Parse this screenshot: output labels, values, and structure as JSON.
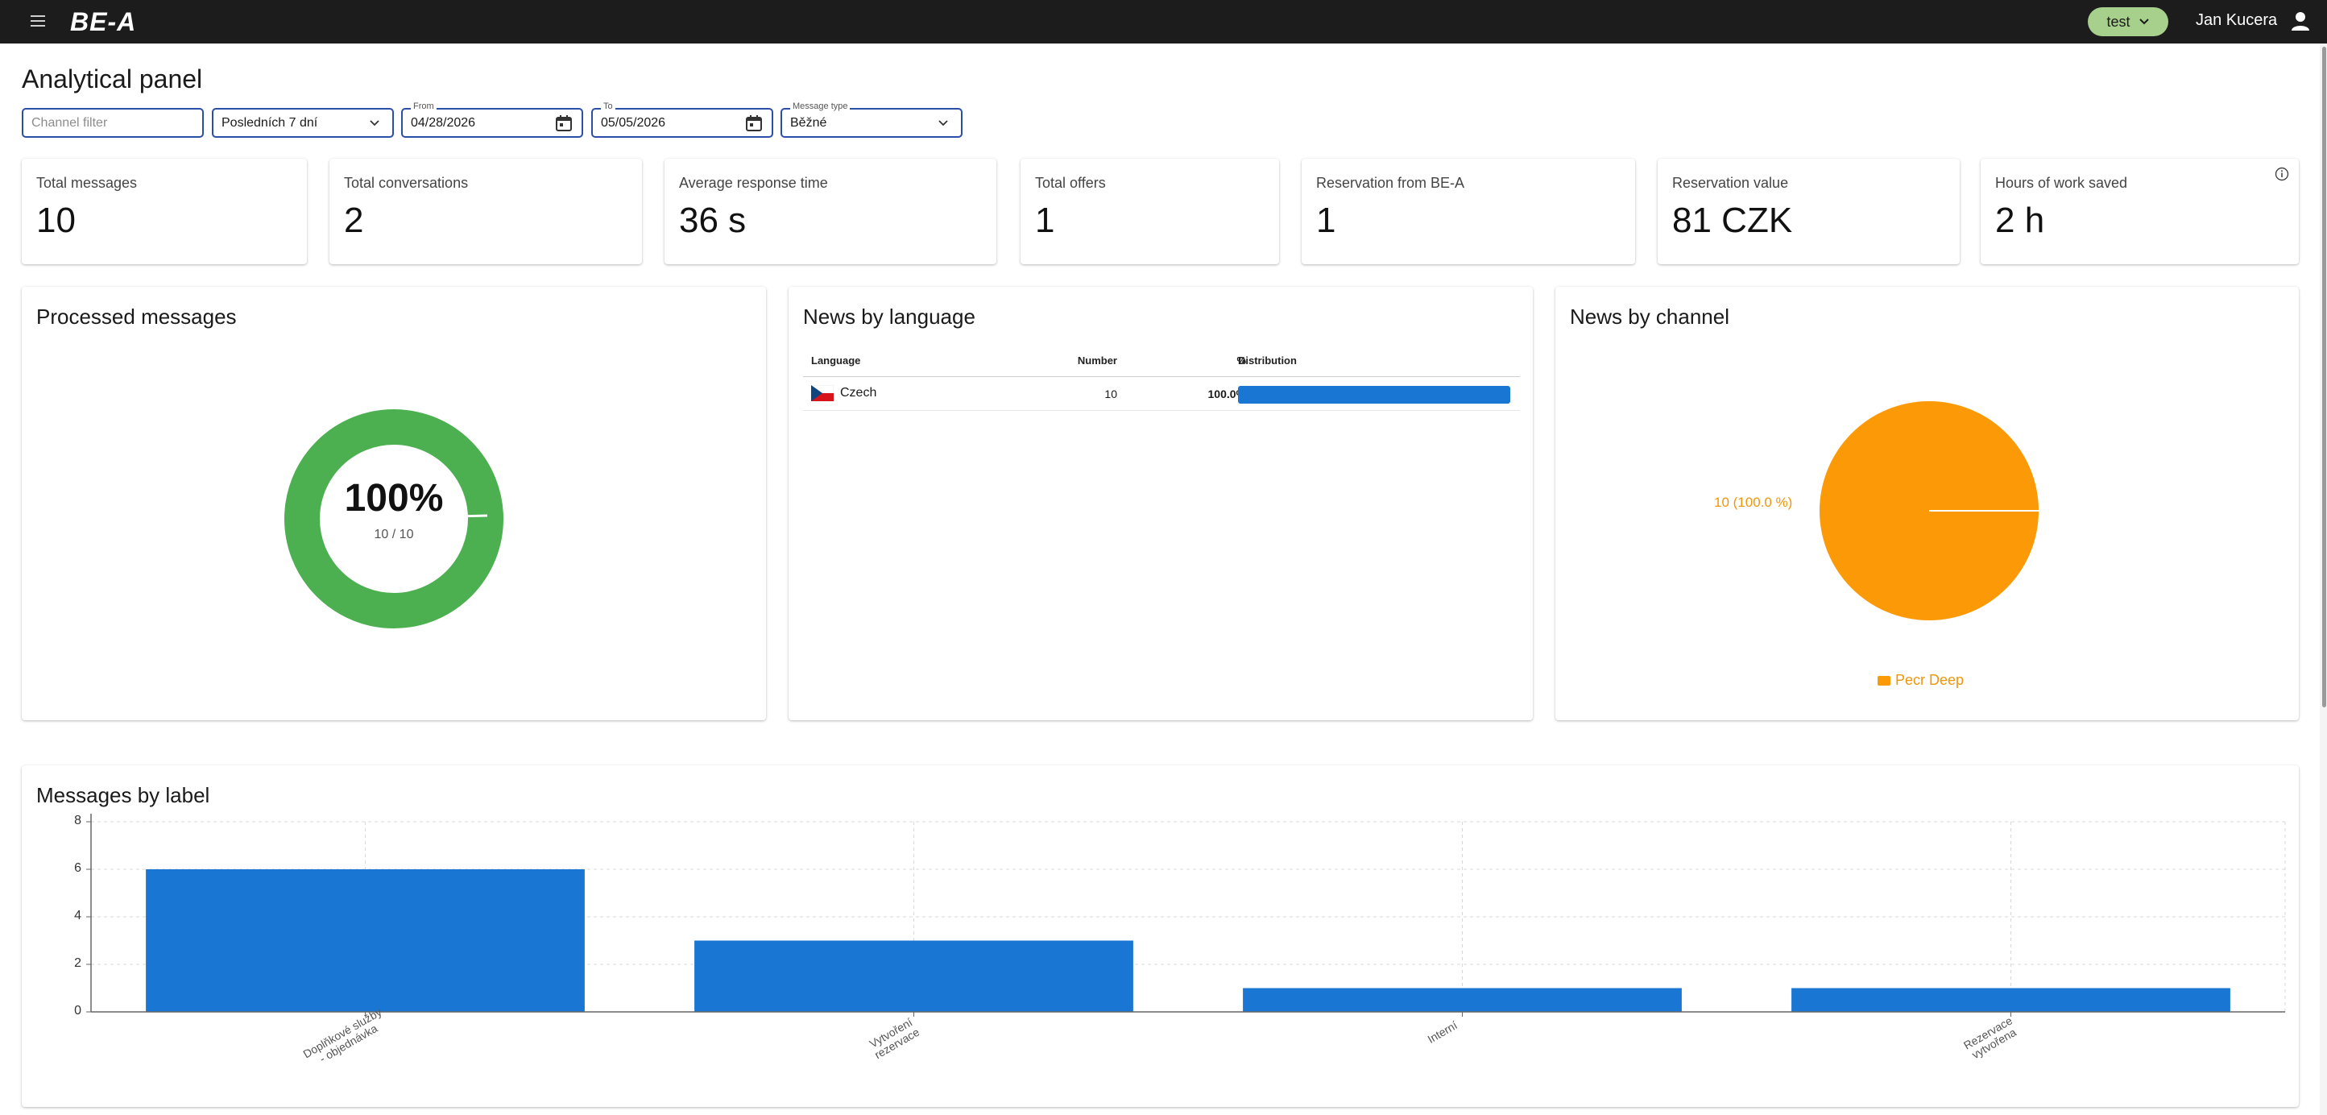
{
  "app": {
    "logo": "BE-A",
    "environment": "test",
    "user_name": "Jan Kucera"
  },
  "page": {
    "title": "Analytical panel"
  },
  "filters": {
    "channel_placeholder": "Channel filter",
    "period": "Posledních 7 dní",
    "from_label": "From",
    "from_value": "04/28/2026",
    "to_label": "To",
    "to_value": "05/05/2026",
    "message_type_label": "Message type",
    "message_type_value": "Běžné"
  },
  "stats": [
    {
      "label": "Total messages",
      "value": "10"
    },
    {
      "label": "Total conversations",
      "value": "2"
    },
    {
      "label": "Average response time",
      "value": "36 s"
    },
    {
      "label": "Total offers",
      "value": "1"
    },
    {
      "label": "Reservation from BE-A",
      "value": "1"
    },
    {
      "label": "Reservation value",
      "value": "81 CZK"
    },
    {
      "label": "Hours of work saved",
      "value": "2 h"
    }
  ],
  "processed": {
    "title": "Processed messages",
    "percent_text": "100%",
    "ratio_text": "10 / 10",
    "fraction": 0.995,
    "color": "#4caf50"
  },
  "language": {
    "title": "News by language",
    "headers": {
      "language": "Language",
      "number": "Number",
      "percent": "%",
      "distribution": "Distribution"
    },
    "rows": [
      {
        "language": "Czech",
        "number": "10",
        "percent": "100.0%",
        "share": 1.0
      }
    ],
    "bar_color": "#1976d2"
  },
  "channel": {
    "title": "News by channel",
    "slice_label": "10 (100.0 %)",
    "legend": "Pecr Deep",
    "color": "#fb9a06"
  },
  "label_chart": {
    "title": "Messages by label"
  },
  "chart_data": {
    "type": "bar",
    "title": "Messages by label",
    "categories": [
      "Doplňkové služby\n- objednávka",
      "Vytvoření\nrezervace",
      "Interní",
      "Rezervace\nvytvořena"
    ],
    "values": [
      6,
      3,
      1,
      1
    ],
    "yticks": [
      0,
      2,
      4,
      6,
      8
    ],
    "ylim": [
      0,
      8
    ],
    "grid": true,
    "color": "#1976d2"
  }
}
